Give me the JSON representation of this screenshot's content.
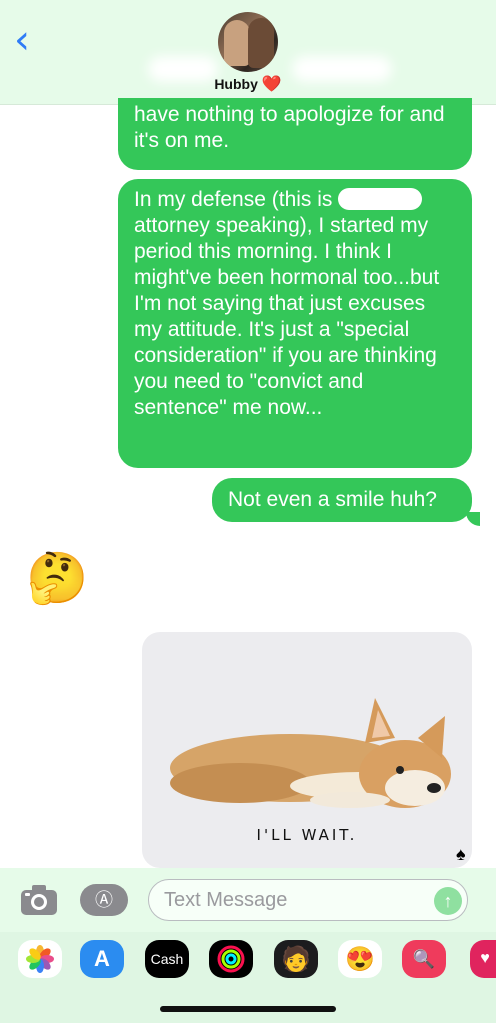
{
  "header": {
    "back_icon": "chevron-left-icon",
    "contact_name": "Hubby",
    "contact_heart": "❤️"
  },
  "messages": [
    {
      "text": "have nothing to apologize for and it's on me.",
      "sender": "me"
    },
    {
      "text_before": "In my defense (this is",
      "text_after": "attorney speaking), I started my period this morning. I think I might've been hormonal too...but I'm not saying that just excuses my attitude. It's just a \"special consideration\" if you are thinking you need to \"convict and sentence\" me now...",
      "sender": "me"
    },
    {
      "text": "Not even a smile huh?",
      "sender": "me"
    },
    {
      "emoji": "🤔",
      "sender": "them"
    },
    {
      "gif_caption": "I'LL WAIT.",
      "sender": "them"
    }
  ],
  "compose": {
    "placeholder": "Text Message",
    "camera_icon": "camera-icon",
    "apps_icon": "app-store-icon",
    "send_icon": "arrow-up-icon"
  },
  "drawer": {
    "apps": [
      "Photos",
      "App Store",
      "Cash",
      "Fitness",
      "Memoji",
      "Memoji Stickers",
      "Images",
      "Digital Touch"
    ],
    "cash_label": "Cash"
  },
  "colors": {
    "bubble": "#34c759",
    "accent": "#2f7cf6",
    "header_bg": "#e6fbe9"
  }
}
